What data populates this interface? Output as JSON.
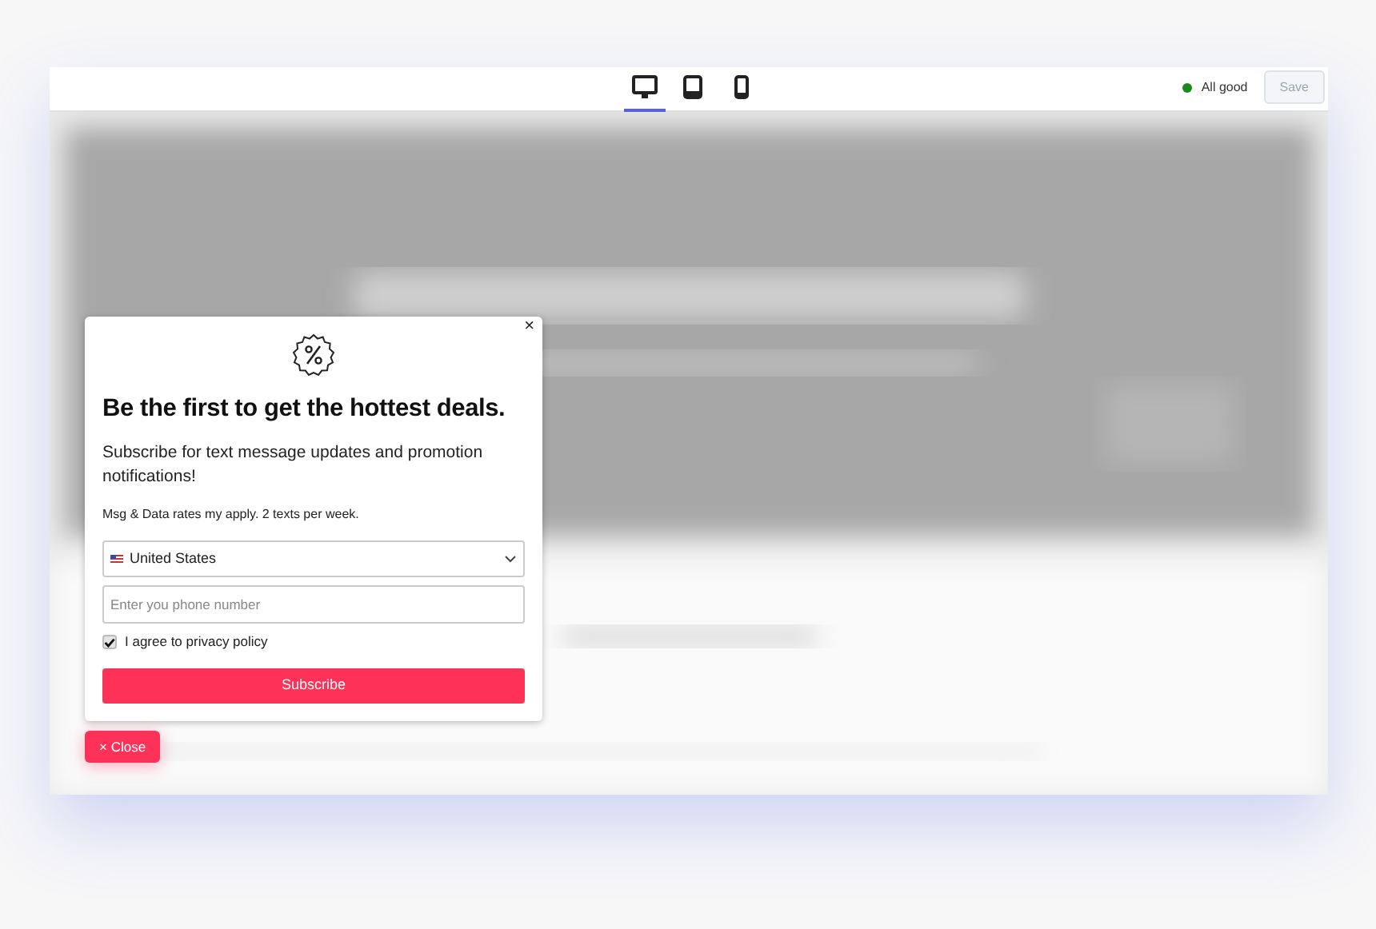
{
  "toolbar": {
    "devices": [
      {
        "kind": "desktop",
        "selected": true
      },
      {
        "kind": "tablet",
        "selected": false
      },
      {
        "kind": "mobile",
        "selected": false
      }
    ],
    "status": {
      "text": "All good",
      "color": "#1a8a1a"
    },
    "save_button": {
      "label": "Save",
      "disabled": true
    }
  },
  "popup": {
    "close_glyph": "×",
    "title": "Be the first to get the hottest deals.",
    "subtitle": "Subscribe for text message updates and promotion notifications!",
    "disclaimer": "Msg & Data rates my apply. 2 texts per week.",
    "country_select": {
      "value": "United States"
    },
    "phone_field": {
      "placeholder": "Enter you phone number"
    },
    "consent": {
      "label": "I agree to privacy policy",
      "checked": true
    },
    "subscribe_button": {
      "label": "Subscribe"
    }
  },
  "close_button": {
    "label": "× Close"
  }
}
